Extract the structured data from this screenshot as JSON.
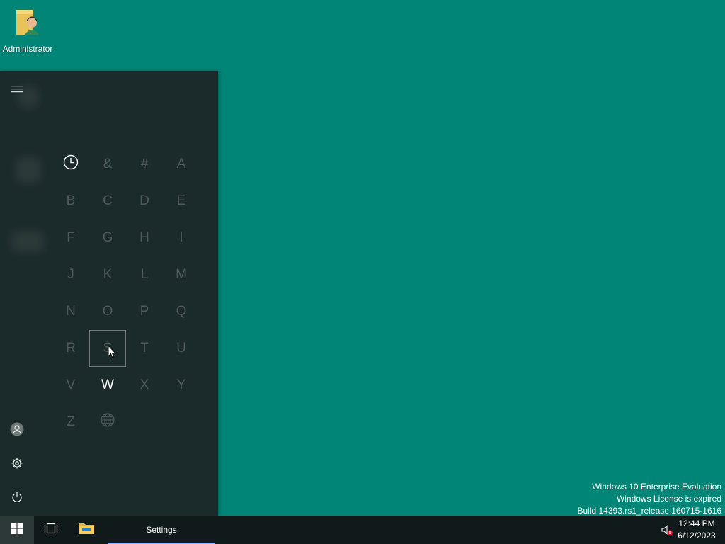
{
  "desktop": {
    "icons": [
      {
        "label": "Administrator",
        "icon": "user-folder-icon"
      }
    ]
  },
  "start_menu": {
    "rail": {
      "menu_icon": "hamburger-icon",
      "user_icon": "user-icon",
      "settings_icon": "gear-icon",
      "power_icon": "power-icon"
    },
    "alpha_grid": [
      {
        "key": "recent",
        "label": "",
        "icon": "clock-icon",
        "active": true
      },
      {
        "key": "amp",
        "label": "&",
        "active": false
      },
      {
        "key": "hash",
        "label": "#",
        "active": false
      },
      {
        "key": "A",
        "label": "A",
        "active": false
      },
      {
        "key": "B",
        "label": "B",
        "active": false
      },
      {
        "key": "C",
        "label": "C",
        "active": false
      },
      {
        "key": "D",
        "label": "D",
        "active": false
      },
      {
        "key": "E",
        "label": "E",
        "active": false
      },
      {
        "key": "F",
        "label": "F",
        "active": false
      },
      {
        "key": "G",
        "label": "G",
        "active": false
      },
      {
        "key": "H",
        "label": "H",
        "active": false
      },
      {
        "key": "I",
        "label": "I",
        "active": false
      },
      {
        "key": "J",
        "label": "J",
        "active": false
      },
      {
        "key": "K",
        "label": "K",
        "active": false
      },
      {
        "key": "L",
        "label": "L",
        "active": false
      },
      {
        "key": "M",
        "label": "M",
        "active": false
      },
      {
        "key": "N",
        "label": "N",
        "active": false
      },
      {
        "key": "O",
        "label": "O",
        "active": false
      },
      {
        "key": "P",
        "label": "P",
        "active": false
      },
      {
        "key": "Q",
        "label": "Q",
        "active": false
      },
      {
        "key": "R",
        "label": "R",
        "active": false
      },
      {
        "key": "S",
        "label": "S",
        "active": false,
        "focused": true
      },
      {
        "key": "T",
        "label": "T",
        "active": false
      },
      {
        "key": "U",
        "label": "U",
        "active": false
      },
      {
        "key": "V",
        "label": "V",
        "active": false
      },
      {
        "key": "W",
        "label": "W",
        "active": true
      },
      {
        "key": "X",
        "label": "X",
        "active": false
      },
      {
        "key": "Y",
        "label": "Y",
        "active": false
      },
      {
        "key": "Z",
        "label": "Z",
        "active": false
      },
      {
        "key": "globe",
        "label": "",
        "icon": "globe-icon",
        "active": false
      }
    ]
  },
  "watermark": {
    "line1": "Windows 10 Enterprise Evaluation",
    "line2": "Windows License is expired",
    "line3": "Build 14393.rs1_release.160715-1616"
  },
  "taskbar": {
    "start_icon": "windows-logo-icon",
    "taskview_icon": "task-view-icon",
    "explorer_icon": "file-explorer-icon",
    "active_app_label": "Settings",
    "tray": {
      "volume_icon": "volume-muted-icon",
      "time": "12:44 PM",
      "date": "6/12/2023"
    }
  },
  "colors": {
    "desktop": "#008577",
    "start_menu": "#1b2a2a",
    "taskbar": "#101a1a",
    "accent_underline": "#8fb8ff"
  }
}
